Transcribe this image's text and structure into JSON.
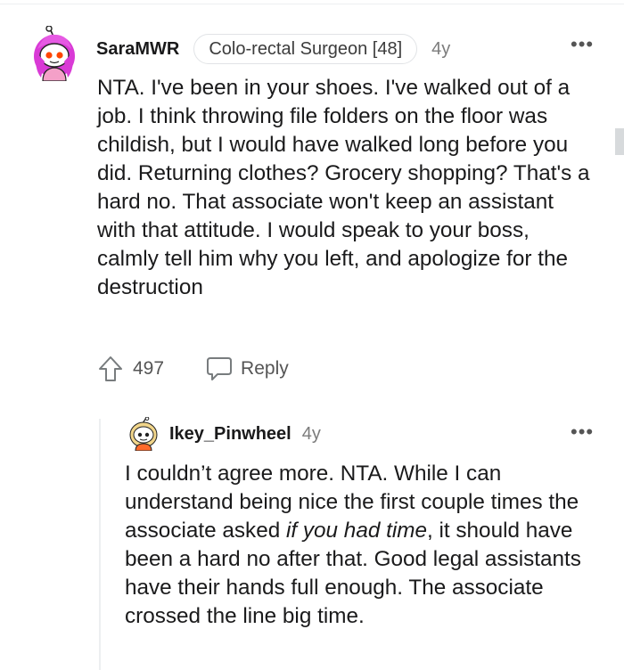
{
  "comment": {
    "author": "SaraMWR",
    "flair": "Colo-rectal Surgeon [48]",
    "age": "4y",
    "more": "•••",
    "body": "NTA. I've been in your shoes. I've walked out of a job. I think throwing file folders on the floor was childish, but I would have walked long before you did. Returning clothes? Grocery shopping? That's a hard no. That associate won't keep an assistant with that attitude. I would speak to your boss, calmly tell him why you left, and apologize for the destruction",
    "score": "497",
    "reply_label": "Reply",
    "avatar_icon": "snoo-avatar-pink-hair"
  },
  "reply": {
    "author": "Ikey_Pinwheel",
    "age": "4y",
    "more": "•••",
    "body_before": "I couldn’t agree more. NTA. While I can understand being nice the first couple times the associate asked ",
    "body_italic": "if you had time",
    "body_after": ", it should have been a hard no after that. Good legal assistants have their hands full enough. The associate crossed the line big time.",
    "avatar_icon": "snoo-avatar-blonde"
  },
  "colors": {
    "text": "#1a1a1b",
    "meta": "#7c7c7c",
    "avatar_pink": "#d93ad6"
  }
}
